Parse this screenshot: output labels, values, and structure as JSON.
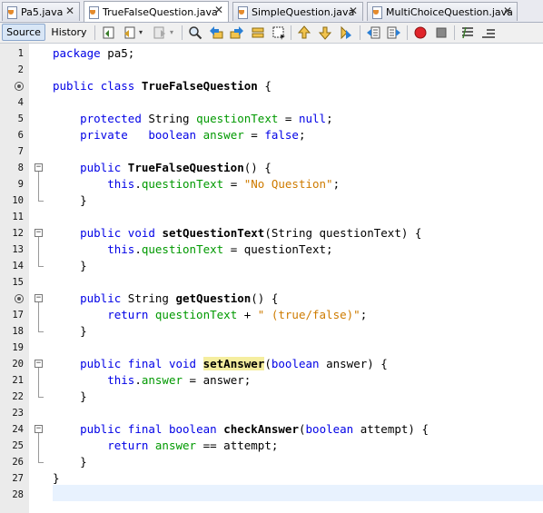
{
  "tabs": [
    {
      "label": "Pa5.java",
      "active": false
    },
    {
      "label": "TrueFalseQuestion.java",
      "active": true
    },
    {
      "label": "SimpleQuestion.java",
      "active": false
    },
    {
      "label": "MultiChoiceQuestion.java",
      "active": false
    }
  ],
  "toolbar": {
    "source_label": "Source",
    "history_label": "History",
    "icons": [
      "last-edit-icon",
      "back-icon",
      "forward-icon",
      "find-icon",
      "find-previous-icon",
      "find-next-icon",
      "toggle-highlight-icon",
      "toggle-rectangular-selection-icon",
      "previous-bookmark-icon",
      "next-bookmark-icon",
      "toggle-bookmark-icon",
      "shift-left-icon",
      "shift-right-icon",
      "start-macro-icon",
      "stop-macro-icon",
      "comment-icon",
      "uncomment-icon"
    ]
  },
  "editor": {
    "line_numbers": [
      "1",
      "2",
      "3",
      "4",
      "5",
      "6",
      "7",
      "8",
      "9",
      "10",
      "11",
      "12",
      "13",
      "14",
      "15",
      "16",
      "17",
      "18",
      "19",
      "20",
      "21",
      "22",
      "23",
      "24",
      "25",
      "26",
      "27",
      "28"
    ],
    "lines": [
      {
        "indent": "",
        "tokens": [
          {
            "t": "package",
            "c": "kw"
          },
          {
            "t": " pa5;",
            "c": ""
          }
        ]
      },
      {
        "indent": "",
        "tokens": []
      },
      {
        "indent": "",
        "tokens": [
          {
            "t": "public",
            "c": "kw"
          },
          {
            "t": " ",
            "c": ""
          },
          {
            "t": "class",
            "c": "kw"
          },
          {
            "t": " ",
            "c": ""
          },
          {
            "t": "TrueFalseQuestion",
            "c": "bold"
          },
          {
            "t": " {",
            "c": ""
          }
        ]
      },
      {
        "indent": "",
        "tokens": []
      },
      {
        "indent": "    ",
        "tokens": [
          {
            "t": "protected",
            "c": "kw"
          },
          {
            "t": " String ",
            "c": ""
          },
          {
            "t": "questionText",
            "c": "fld"
          },
          {
            "t": " = ",
            "c": ""
          },
          {
            "t": "null",
            "c": "kw"
          },
          {
            "t": ";",
            "c": ""
          }
        ]
      },
      {
        "indent": "    ",
        "tokens": [
          {
            "t": "private",
            "c": "kw"
          },
          {
            "t": "   ",
            "c": ""
          },
          {
            "t": "boolean",
            "c": "kw"
          },
          {
            "t": " ",
            "c": ""
          },
          {
            "t": "answer",
            "c": "fld"
          },
          {
            "t": " = ",
            "c": ""
          },
          {
            "t": "false",
            "c": "kw"
          },
          {
            "t": ";",
            "c": ""
          }
        ]
      },
      {
        "indent": "",
        "tokens": []
      },
      {
        "indent": "    ",
        "tokens": [
          {
            "t": "public",
            "c": "kw"
          },
          {
            "t": " ",
            "c": ""
          },
          {
            "t": "TrueFalseQuestion",
            "c": "bold"
          },
          {
            "t": "() {",
            "c": ""
          }
        ]
      },
      {
        "indent": "        ",
        "tokens": [
          {
            "t": "this",
            "c": "kw"
          },
          {
            "t": ".",
            "c": ""
          },
          {
            "t": "questionText",
            "c": "fld"
          },
          {
            "t": " = ",
            "c": ""
          },
          {
            "t": "\"No Question\"",
            "c": "str"
          },
          {
            "t": ";",
            "c": ""
          }
        ]
      },
      {
        "indent": "    ",
        "tokens": [
          {
            "t": "}",
            "c": ""
          }
        ]
      },
      {
        "indent": "",
        "tokens": []
      },
      {
        "indent": "    ",
        "tokens": [
          {
            "t": "public",
            "c": "kw"
          },
          {
            "t": " ",
            "c": ""
          },
          {
            "t": "void",
            "c": "kw"
          },
          {
            "t": " ",
            "c": ""
          },
          {
            "t": "setQuestionText",
            "c": "bold"
          },
          {
            "t": "(String questionText) {",
            "c": ""
          }
        ]
      },
      {
        "indent": "        ",
        "tokens": [
          {
            "t": "this",
            "c": "kw"
          },
          {
            "t": ".",
            "c": ""
          },
          {
            "t": "questionText",
            "c": "fld"
          },
          {
            "t": " = questionText;",
            "c": ""
          }
        ]
      },
      {
        "indent": "    ",
        "tokens": [
          {
            "t": "}",
            "c": ""
          }
        ]
      },
      {
        "indent": "",
        "tokens": []
      },
      {
        "indent": "    ",
        "tokens": [
          {
            "t": "public",
            "c": "kw"
          },
          {
            "t": " String ",
            "c": ""
          },
          {
            "t": "getQuestion",
            "c": "bold"
          },
          {
            "t": "() {",
            "c": ""
          }
        ]
      },
      {
        "indent": "        ",
        "tokens": [
          {
            "t": "return",
            "c": "kw"
          },
          {
            "t": " ",
            "c": ""
          },
          {
            "t": "questionText",
            "c": "fld"
          },
          {
            "t": " + ",
            "c": ""
          },
          {
            "t": "\" (true/false)\"",
            "c": "str"
          },
          {
            "t": ";",
            "c": ""
          }
        ]
      },
      {
        "indent": "    ",
        "tokens": [
          {
            "t": "}",
            "c": ""
          }
        ]
      },
      {
        "indent": "",
        "tokens": []
      },
      {
        "indent": "    ",
        "tokens": [
          {
            "t": "public",
            "c": "kw"
          },
          {
            "t": " ",
            "c": ""
          },
          {
            "t": "final",
            "c": "kw"
          },
          {
            "t": " ",
            "c": ""
          },
          {
            "t": "void",
            "c": "kw"
          },
          {
            "t": " ",
            "c": ""
          },
          {
            "t": "setAnswer",
            "c": "bold hl"
          },
          {
            "t": "(",
            "c": ""
          },
          {
            "t": "boolean",
            "c": "kw"
          },
          {
            "t": " answer) {",
            "c": ""
          }
        ]
      },
      {
        "indent": "        ",
        "tokens": [
          {
            "t": "this",
            "c": "kw"
          },
          {
            "t": ".",
            "c": ""
          },
          {
            "t": "answer",
            "c": "fld"
          },
          {
            "t": " = answer;",
            "c": ""
          }
        ]
      },
      {
        "indent": "    ",
        "tokens": [
          {
            "t": "}",
            "c": ""
          }
        ]
      },
      {
        "indent": "",
        "tokens": []
      },
      {
        "indent": "    ",
        "tokens": [
          {
            "t": "public",
            "c": "kw"
          },
          {
            "t": " ",
            "c": ""
          },
          {
            "t": "final",
            "c": "kw"
          },
          {
            "t": " ",
            "c": ""
          },
          {
            "t": "boolean",
            "c": "kw"
          },
          {
            "t": " ",
            "c": ""
          },
          {
            "t": "checkAnswer",
            "c": "bold"
          },
          {
            "t": "(",
            "c": ""
          },
          {
            "t": "boolean",
            "c": "kw"
          },
          {
            "t": " attempt) {",
            "c": ""
          }
        ]
      },
      {
        "indent": "        ",
        "tokens": [
          {
            "t": "return",
            "c": "kw"
          },
          {
            "t": " ",
            "c": ""
          },
          {
            "t": "answer",
            "c": "fld"
          },
          {
            "t": " == attempt;",
            "c": ""
          }
        ]
      },
      {
        "indent": "    ",
        "tokens": [
          {
            "t": "}",
            "c": ""
          }
        ]
      },
      {
        "indent": "",
        "tokens": [
          {
            "t": "}",
            "c": ""
          }
        ]
      },
      {
        "indent": "",
        "tokens": []
      }
    ],
    "override_marker_lines": [
      "3",
      "16"
    ],
    "colors": {
      "keyword": "#0000e6",
      "field": "#009900",
      "string": "#ce7b00",
      "highlight": "#f5ee9f",
      "current_line": "#e8f2fe"
    }
  }
}
